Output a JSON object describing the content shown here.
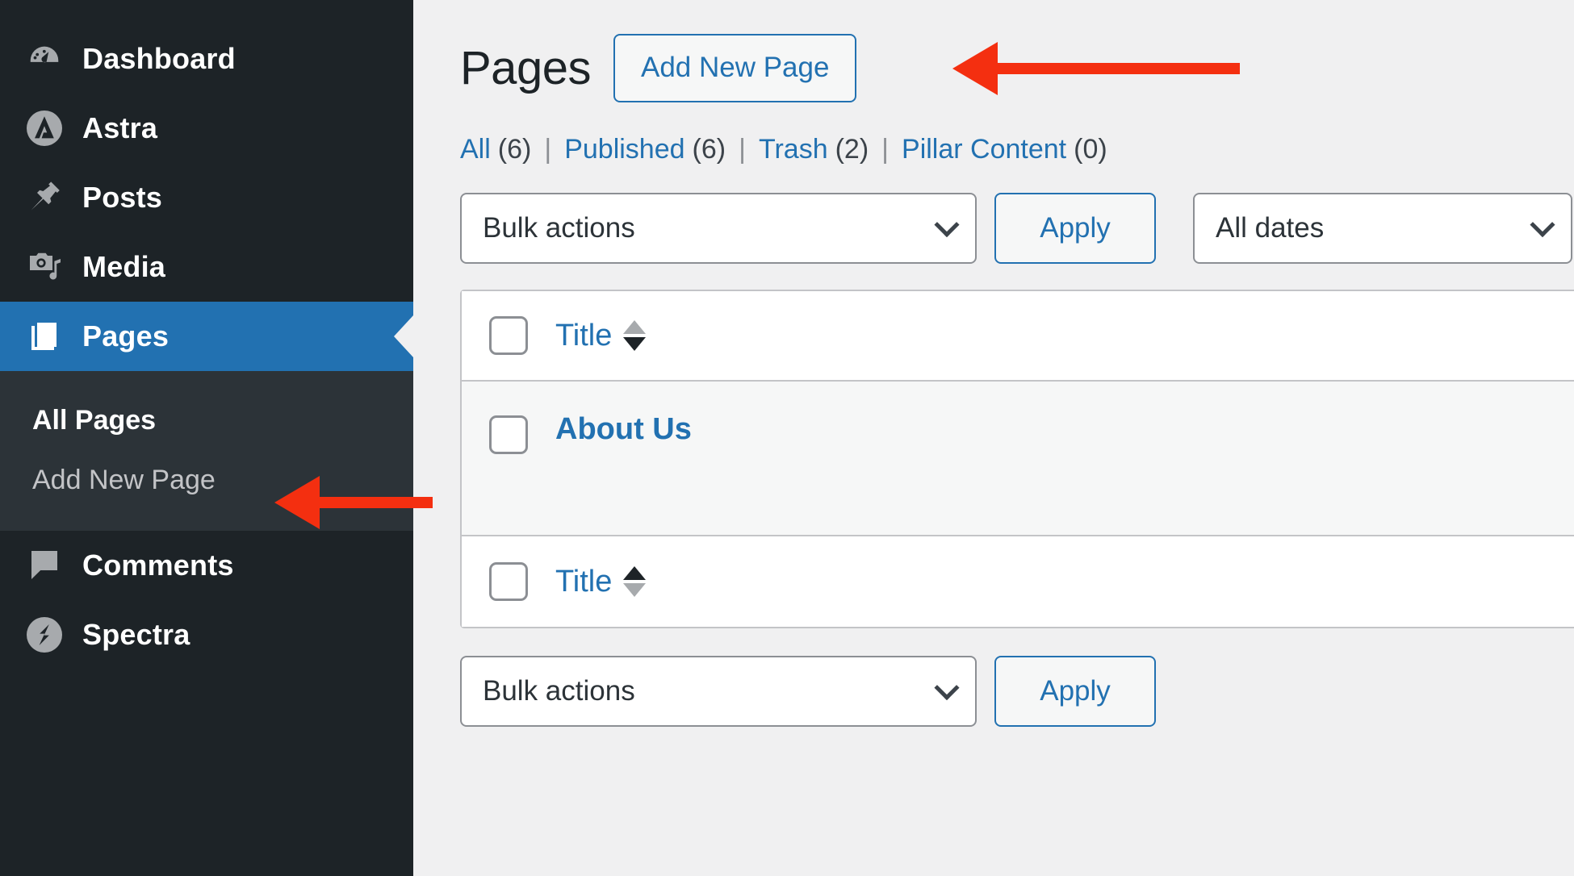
{
  "sidebar": {
    "items": [
      {
        "label": "Dashboard",
        "icon": "dashboard-icon",
        "name": "sidebar-item-dashboard",
        "current": false
      },
      {
        "label": "Astra",
        "icon": "astra-icon",
        "name": "sidebar-item-astra",
        "current": false
      },
      {
        "label": "Posts",
        "icon": "pin-icon",
        "name": "sidebar-item-posts",
        "current": false
      },
      {
        "label": "Media",
        "icon": "media-icon",
        "name": "sidebar-item-media",
        "current": false
      },
      {
        "label": "Pages",
        "icon": "pages-icon",
        "name": "sidebar-item-pages",
        "current": true
      },
      {
        "label": "Comments",
        "icon": "comment-icon",
        "name": "sidebar-item-comments",
        "current": false
      },
      {
        "label": "Spectra",
        "icon": "spectra-icon",
        "name": "sidebar-item-spectra",
        "current": false
      }
    ],
    "submenu": [
      {
        "label": "All Pages",
        "name": "submenu-item-all-pages",
        "current": true
      },
      {
        "label": "Add New Page",
        "name": "submenu-item-add-new-page",
        "current": false
      }
    ]
  },
  "header": {
    "title": "Pages",
    "add_new_label": "Add New Page"
  },
  "filters": {
    "links": [
      {
        "label": "All",
        "count": "(6)"
      },
      {
        "label": "Published",
        "count": "(6)"
      },
      {
        "label": "Trash",
        "count": "(2)"
      },
      {
        "label": "Pillar Content",
        "count": "(0)"
      }
    ],
    "separator": "|"
  },
  "tablenav_top": {
    "bulk_actions_value": "Bulk actions",
    "apply_label": "Apply",
    "dates_value": "All dates"
  },
  "tablenav_bottom": {
    "bulk_actions_value": "Bulk actions",
    "apply_label": "Apply"
  },
  "table": {
    "column_title": "Title",
    "footer_title": "Title",
    "rows": [
      {
        "title": "About Us"
      }
    ]
  },
  "colors": {
    "accent_blue": "#2271b1",
    "sidebar_bg": "#1d2327",
    "submenu_bg": "#2c3338",
    "annotation_red": "#f42f10",
    "page_bg": "#f0f0f1"
  }
}
